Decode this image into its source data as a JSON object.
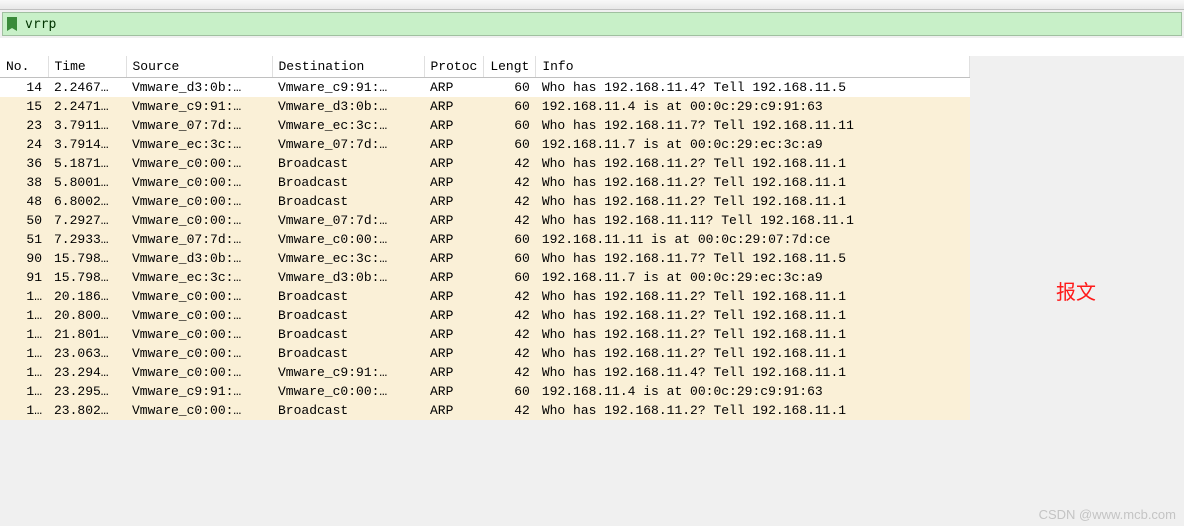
{
  "toolbar": {
    "icons": [
      "prev",
      "next",
      "jump",
      "home",
      "reload",
      "stop",
      "autoscroll",
      "colorize",
      "zoom-in",
      "zoom-out",
      "zoom-reset",
      "resize-cols"
    ]
  },
  "filter": {
    "value": "vrrp"
  },
  "columns": {
    "no": "No.",
    "time": "Time",
    "source": "Source",
    "destination": "Destination",
    "protocol": "Protoc",
    "length": "Lengt",
    "info": "Info"
  },
  "rows": [
    {
      "no": "14",
      "time": "2.2467…",
      "src": "Vmware_d3:0b:…",
      "dst": "Vmware_c9:91:…",
      "proto": "ARP",
      "len": "60",
      "info": "Who has 192.168.11.4? Tell 192.168.11.5",
      "bg": "white"
    },
    {
      "no": "15",
      "time": "2.2471…",
      "src": "Vmware_c9:91:…",
      "dst": "Vmware_d3:0b:…",
      "proto": "ARP",
      "len": "60",
      "info": "192.168.11.4 is at 00:0c:29:c9:91:63",
      "bg": "cream"
    },
    {
      "no": "23",
      "time": "3.7911…",
      "src": "Vmware_07:7d:…",
      "dst": "Vmware_ec:3c:…",
      "proto": "ARP",
      "len": "60",
      "info": "Who has 192.168.11.7? Tell 192.168.11.11",
      "bg": "cream"
    },
    {
      "no": "24",
      "time": "3.7914…",
      "src": "Vmware_ec:3c:…",
      "dst": "Vmware_07:7d:…",
      "proto": "ARP",
      "len": "60",
      "info": "192.168.11.7 is at 00:0c:29:ec:3c:a9",
      "bg": "cream"
    },
    {
      "no": "36",
      "time": "5.1871…",
      "src": "Vmware_c0:00:…",
      "dst": "Broadcast",
      "proto": "ARP",
      "len": "42",
      "info": "Who has 192.168.11.2? Tell 192.168.11.1",
      "bg": "cream"
    },
    {
      "no": "38",
      "time": "5.8001…",
      "src": "Vmware_c0:00:…",
      "dst": "Broadcast",
      "proto": "ARP",
      "len": "42",
      "info": "Who has 192.168.11.2? Tell 192.168.11.1",
      "bg": "cream"
    },
    {
      "no": "48",
      "time": "6.8002…",
      "src": "Vmware_c0:00:…",
      "dst": "Broadcast",
      "proto": "ARP",
      "len": "42",
      "info": "Who has 192.168.11.2? Tell 192.168.11.1",
      "bg": "cream"
    },
    {
      "no": "50",
      "time": "7.2927…",
      "src": "Vmware_c0:00:…",
      "dst": "Vmware_07:7d:…",
      "proto": "ARP",
      "len": "42",
      "info": "Who has 192.168.11.11? Tell 192.168.11.1",
      "bg": "cream"
    },
    {
      "no": "51",
      "time": "7.2933…",
      "src": "Vmware_07:7d:…",
      "dst": "Vmware_c0:00:…",
      "proto": "ARP",
      "len": "60",
      "info": "192.168.11.11 is at 00:0c:29:07:7d:ce",
      "bg": "cream"
    },
    {
      "no": "90",
      "time": "15.798…",
      "src": "Vmware_d3:0b:…",
      "dst": "Vmware_ec:3c:…",
      "proto": "ARP",
      "len": "60",
      "info": "Who has 192.168.11.7? Tell 192.168.11.5",
      "bg": "cream"
    },
    {
      "no": "91",
      "time": "15.798…",
      "src": "Vmware_ec:3c:…",
      "dst": "Vmware_d3:0b:…",
      "proto": "ARP",
      "len": "60",
      "info": "192.168.11.7 is at 00:0c:29:ec:3c:a9",
      "bg": "cream"
    },
    {
      "no": "1…",
      "time": "20.186…",
      "src": "Vmware_c0:00:…",
      "dst": "Broadcast",
      "proto": "ARP",
      "len": "42",
      "info": "Who has 192.168.11.2? Tell 192.168.11.1",
      "bg": "cream"
    },
    {
      "no": "1…",
      "time": "20.800…",
      "src": "Vmware_c0:00:…",
      "dst": "Broadcast",
      "proto": "ARP",
      "len": "42",
      "info": "Who has 192.168.11.2? Tell 192.168.11.1",
      "bg": "cream"
    },
    {
      "no": "1…",
      "time": "21.801…",
      "src": "Vmware_c0:00:…",
      "dst": "Broadcast",
      "proto": "ARP",
      "len": "42",
      "info": "Who has 192.168.11.2? Tell 192.168.11.1",
      "bg": "cream"
    },
    {
      "no": "1…",
      "time": "23.063…",
      "src": "Vmware_c0:00:…",
      "dst": "Broadcast",
      "proto": "ARP",
      "len": "42",
      "info": "Who has 192.168.11.2? Tell 192.168.11.1",
      "bg": "cream"
    },
    {
      "no": "1…",
      "time": "23.294…",
      "src": "Vmware_c0:00:…",
      "dst": "Vmware_c9:91:…",
      "proto": "ARP",
      "len": "42",
      "info": "Who has 192.168.11.4? Tell 192.168.11.1",
      "bg": "cream"
    },
    {
      "no": "1…",
      "time": "23.295…",
      "src": "Vmware_c9:91:…",
      "dst": "Vmware_c0:00:…",
      "proto": "ARP",
      "len": "60",
      "info": "192.168.11.4 is at 00:0c:29:c9:91:63",
      "bg": "cream"
    },
    {
      "no": "1…",
      "time": "23.802…",
      "src": "Vmware_c0:00:…",
      "dst": "Broadcast",
      "proto": "ARP",
      "len": "42",
      "info": "Who has 192.168.11.2? Tell 192.168.11.1",
      "bg": "cream"
    }
  ],
  "annotation": "报文",
  "watermark": "CSDN @www.mcb.com"
}
